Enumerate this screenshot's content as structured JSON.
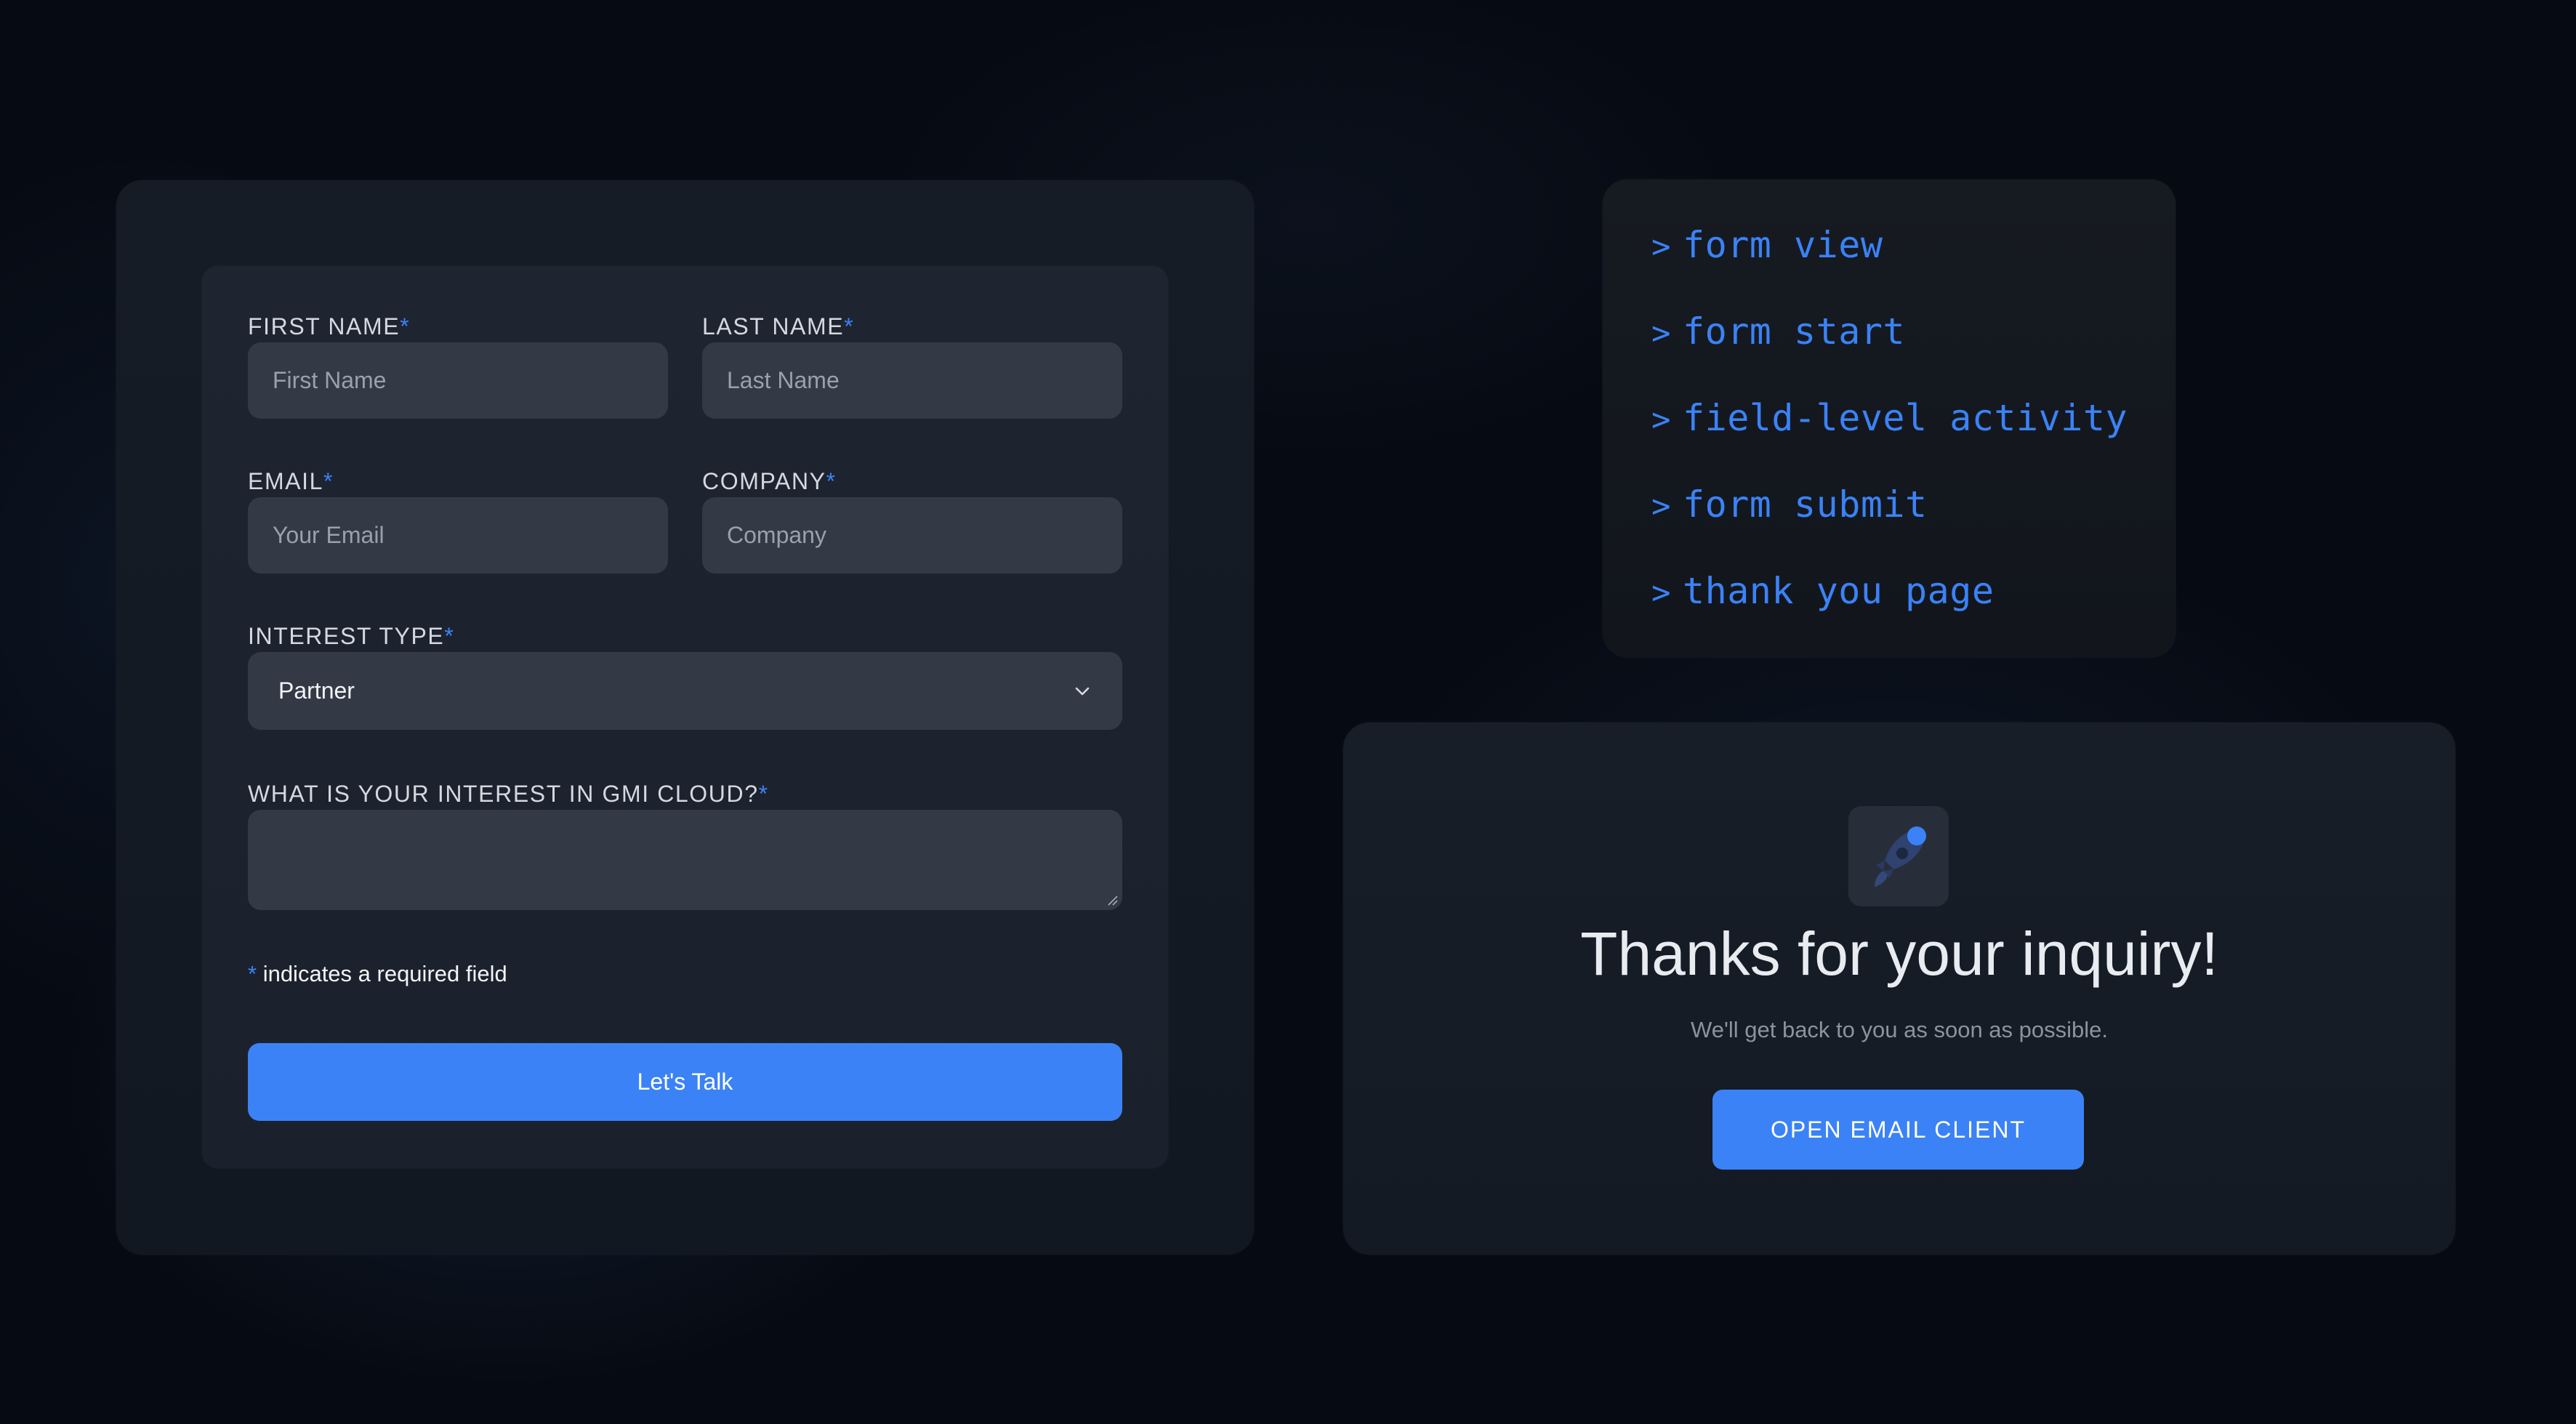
{
  "form": {
    "first_name": {
      "label": "FIRST NAME",
      "required_mark": "*",
      "placeholder": "First Name"
    },
    "last_name": {
      "label": "LAST NAME",
      "required_mark": "*",
      "placeholder": "Last Name"
    },
    "email": {
      "label": "EMAIL",
      "required_mark": "*",
      "placeholder": "Your Email"
    },
    "company": {
      "label": "COMPANY",
      "required_mark": "*",
      "placeholder": "Company"
    },
    "interest_type": {
      "label": "INTEREST TYPE",
      "required_mark": "*",
      "selected": "Partner"
    },
    "interest_text": {
      "label": "WHAT IS YOUR INTEREST IN GMI CLOUD?",
      "required_mark": "*"
    },
    "required_note": {
      "mark": "*",
      "text": " indicates a required field"
    },
    "submit_label": "Let's Talk"
  },
  "events": {
    "prompt": ">",
    "lines": [
      "form view",
      "form start",
      "field-level activity",
      "form submit",
      "thank you page"
    ]
  },
  "thanks": {
    "icon": "rocket-icon",
    "title": "Thanks for your inquiry!",
    "subtitle": "We'll get back to you as soon as possible.",
    "button_label": "OPEN EMAIL CLIENT"
  },
  "colors": {
    "accent": "#3b82f6",
    "background": "#060a12",
    "input_bg": "#333a46"
  }
}
